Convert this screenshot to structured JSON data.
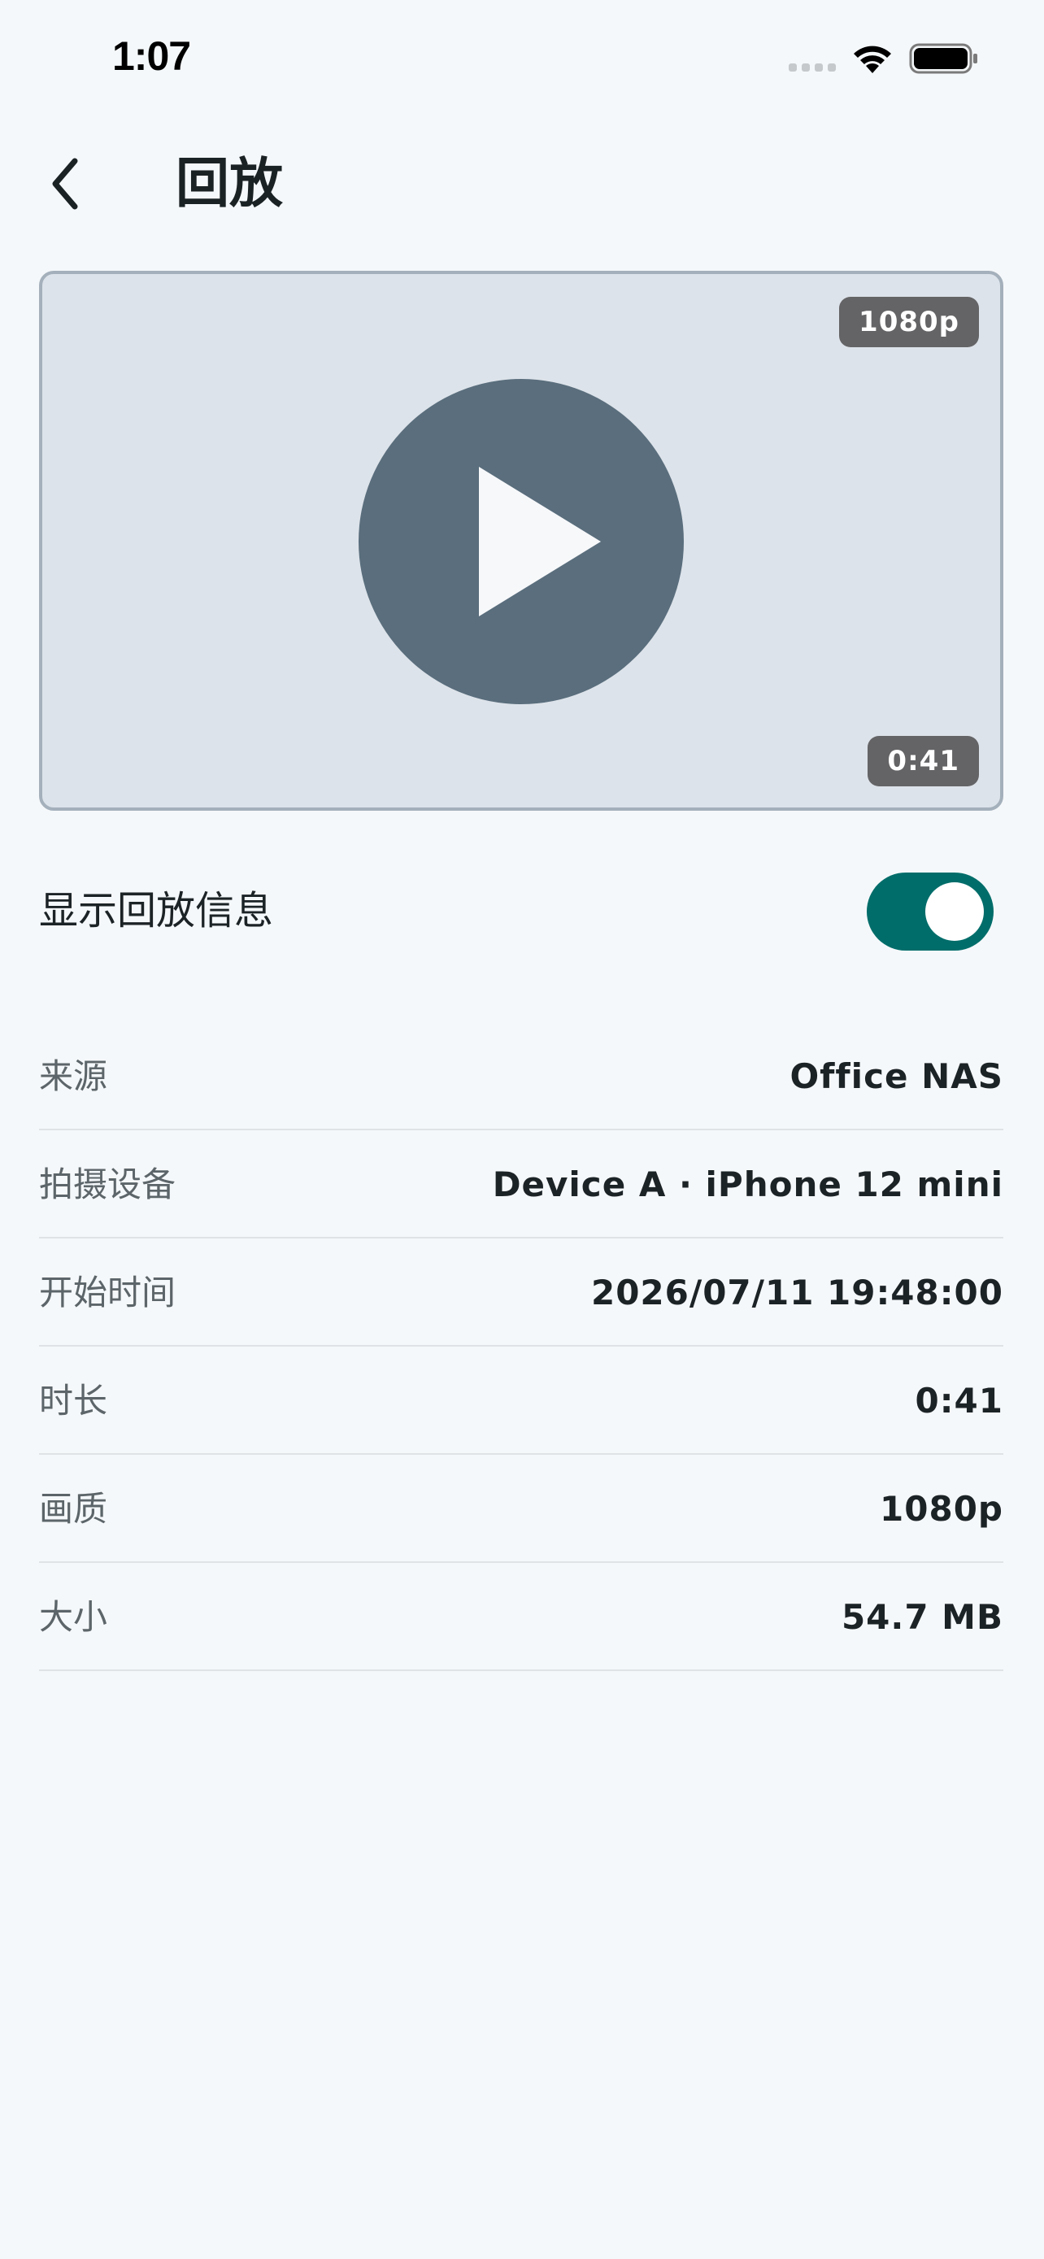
{
  "status_bar": {
    "time": "1:07"
  },
  "header": {
    "title": "回放",
    "back_icon": "chevron-left-icon"
  },
  "video": {
    "quality_badge": "1080p",
    "duration_badge": "0:41",
    "play_icon": "play-icon"
  },
  "toggle": {
    "label": "显示回放信息",
    "on": true,
    "accent_color": "#006d6a"
  },
  "info": [
    {
      "label": "来源",
      "value": "Office NAS"
    },
    {
      "label": "拍摄设备",
      "value": "Device A · iPhone 12 mini"
    },
    {
      "label": "开始时间",
      "value": "2026/07/11 19:48:00"
    },
    {
      "label": "时长",
      "value": "0:41"
    },
    {
      "label": "画质",
      "value": "1080p"
    },
    {
      "label": "大小",
      "value": "54.7 MB"
    }
  ]
}
